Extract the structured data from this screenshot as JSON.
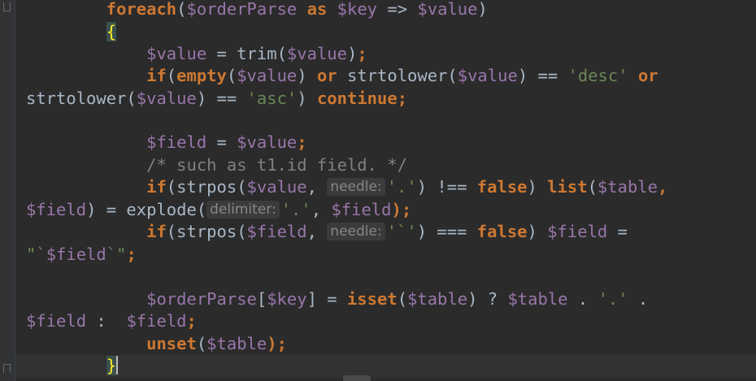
{
  "editor": {
    "lines": [
      {
        "indent": "        ",
        "tokens": [
          {
            "t": "foreach",
            "c": "kw"
          },
          {
            "t": "(",
            "c": "pl"
          },
          {
            "t": "$orderParse",
            "c": "var"
          },
          {
            "t": " ",
            "c": "pl"
          },
          {
            "t": "as",
            "c": "kw"
          },
          {
            "t": " ",
            "c": "pl"
          },
          {
            "t": "$key",
            "c": "var"
          },
          {
            "t": " => ",
            "c": "pl"
          },
          {
            "t": "$value",
            "c": "var"
          },
          {
            "t": ")",
            "c": "pl"
          }
        ]
      },
      {
        "indent": "        ",
        "tokens": [
          {
            "t": "{",
            "c": "bracehl"
          }
        ]
      },
      {
        "indent": "            ",
        "tokens": [
          {
            "t": "$value",
            "c": "var"
          },
          {
            "t": " = ",
            "c": "pl"
          },
          {
            "t": "trim",
            "c": "pl"
          },
          {
            "t": "(",
            "c": "pl"
          },
          {
            "t": "$value",
            "c": "var"
          },
          {
            "t": ")",
            "c": "pl"
          },
          {
            "t": ";",
            "c": "kw"
          }
        ]
      },
      {
        "indent": "            ",
        "tokens": [
          {
            "t": "if",
            "c": "kw"
          },
          {
            "t": "(",
            "c": "pl"
          },
          {
            "t": "empty",
            "c": "kw"
          },
          {
            "t": "(",
            "c": "pl"
          },
          {
            "t": "$value",
            "c": "var"
          },
          {
            "t": ") ",
            "c": "pl"
          },
          {
            "t": "or",
            "c": "kw"
          },
          {
            "t": " strtolower(",
            "c": "pl"
          },
          {
            "t": "$value",
            "c": "var"
          },
          {
            "t": ") == ",
            "c": "pl"
          },
          {
            "t": "'desc'",
            "c": "str"
          },
          {
            "t": " ",
            "c": "pl"
          },
          {
            "t": "or",
            "c": "kw"
          }
        ]
      },
      {
        "indent": "",
        "tokens": [
          {
            "t": "strtolower(",
            "c": "pl"
          },
          {
            "t": "$value",
            "c": "var"
          },
          {
            "t": ") == ",
            "c": "pl"
          },
          {
            "t": "'asc'",
            "c": "str"
          },
          {
            "t": ") ",
            "c": "pl"
          },
          {
            "t": "continue",
            "c": "kw"
          },
          {
            "t": ";",
            "c": "kw"
          }
        ]
      },
      {
        "indent": "",
        "tokens": []
      },
      {
        "indent": "            ",
        "tokens": [
          {
            "t": "$field",
            "c": "var"
          },
          {
            "t": " = ",
            "c": "pl"
          },
          {
            "t": "$value",
            "c": "var"
          },
          {
            "t": ";",
            "c": "kw"
          }
        ]
      },
      {
        "indent": "            ",
        "tokens": [
          {
            "t": "/* such as t1.id field. */",
            "c": "cmt"
          }
        ]
      },
      {
        "indent": "            ",
        "tokens": [
          {
            "t": "if",
            "c": "kw"
          },
          {
            "t": "(strpos(",
            "c": "pl"
          },
          {
            "t": "$value",
            "c": "var"
          },
          {
            "t": ", ",
            "c": "pl"
          },
          {
            "t": "needle:",
            "c": "hint"
          },
          {
            "t": "'.'",
            "c": "str"
          },
          {
            "t": ") !== ",
            "c": "pl"
          },
          {
            "t": "false",
            "c": "kw"
          },
          {
            "t": ") ",
            "c": "pl"
          },
          {
            "t": "list",
            "c": "kw"
          },
          {
            "t": "(",
            "c": "pl"
          },
          {
            "t": "$table",
            "c": "var"
          },
          {
            "t": ",",
            "c": "kw"
          }
        ]
      },
      {
        "indent": "",
        "tokens": [
          {
            "t": "$field",
            "c": "var"
          },
          {
            "t": ") = explode(",
            "c": "pl"
          },
          {
            "t": "delimiter:",
            "c": "hint"
          },
          {
            "t": "'.'",
            "c": "str"
          },
          {
            "t": ", ",
            "c": "pl"
          },
          {
            "t": "$field",
            "c": "var"
          },
          {
            "t": ");",
            "c": "kw"
          }
        ]
      },
      {
        "indent": "            ",
        "tokens": [
          {
            "t": "if",
            "c": "kw"
          },
          {
            "t": "(strpos(",
            "c": "pl"
          },
          {
            "t": "$field",
            "c": "var"
          },
          {
            "t": ", ",
            "c": "pl"
          },
          {
            "t": "needle:",
            "c": "hint"
          },
          {
            "t": "'`'",
            "c": "str"
          },
          {
            "t": ") === ",
            "c": "pl"
          },
          {
            "t": "false",
            "c": "kw"
          },
          {
            "t": ") ",
            "c": "pl"
          },
          {
            "t": "$field",
            "c": "var"
          },
          {
            "t": " =",
            "c": "pl"
          }
        ]
      },
      {
        "indent": "",
        "tokens": [
          {
            "t": "\"`",
            "c": "str"
          },
          {
            "t": "$field",
            "c": "var"
          },
          {
            "t": "`\"",
            "c": "str"
          },
          {
            "t": ";",
            "c": "kw"
          }
        ]
      },
      {
        "indent": "",
        "tokens": []
      },
      {
        "indent": "            ",
        "tokens": [
          {
            "t": "$orderParse",
            "c": "var"
          },
          {
            "t": "[",
            "c": "pl"
          },
          {
            "t": "$key",
            "c": "var"
          },
          {
            "t": "] = ",
            "c": "pl"
          },
          {
            "t": "isset",
            "c": "kw"
          },
          {
            "t": "(",
            "c": "pl"
          },
          {
            "t": "$table",
            "c": "var"
          },
          {
            "t": ") ? ",
            "c": "pl"
          },
          {
            "t": "$table",
            "c": "var"
          },
          {
            "t": " . ",
            "c": "pl"
          },
          {
            "t": "'.'",
            "c": "str"
          },
          {
            "t": " .",
            "c": "pl"
          }
        ]
      },
      {
        "indent": "",
        "tokens": [
          {
            "t": "$field",
            "c": "var"
          },
          {
            "t": " :  ",
            "c": "pl"
          },
          {
            "t": "$field",
            "c": "var"
          },
          {
            "t": ";",
            "c": "kw"
          }
        ]
      },
      {
        "indent": "            ",
        "tokens": [
          {
            "t": "unset",
            "c": "kw"
          },
          {
            "t": "(",
            "c": "pl"
          },
          {
            "t": "$table",
            "c": "var"
          },
          {
            "t": ");",
            "c": "kw"
          }
        ]
      },
      {
        "indent": "        ",
        "tokens": [
          {
            "t": "}",
            "c": "bracehl"
          },
          {
            "t": "",
            "c": "cursor"
          }
        ]
      }
    ]
  },
  "icons": {
    "fold_top": "fold-end-icon",
    "fold_bottom": "fold-start-icon"
  }
}
